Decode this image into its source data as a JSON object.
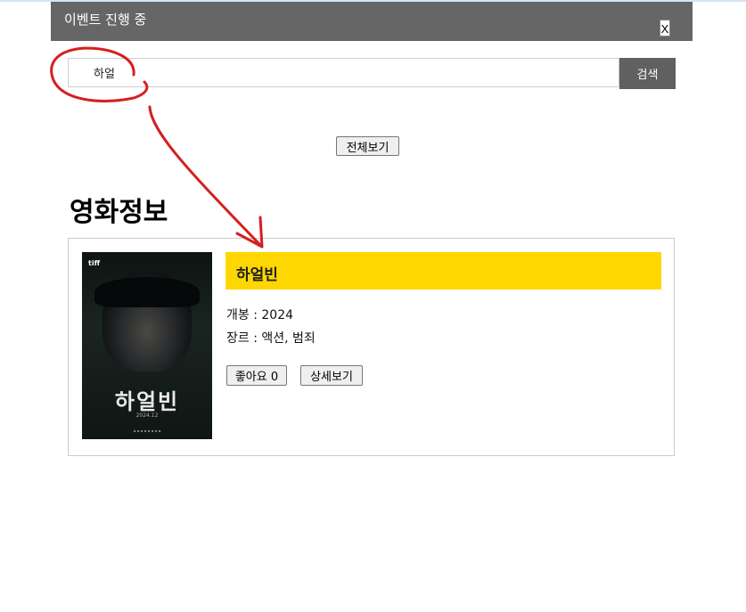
{
  "event_bar": {
    "title": "이벤트 진행 중",
    "close_label": "X"
  },
  "search": {
    "value": "하얼",
    "button_label": "검색"
  },
  "view_all_label": "전체보기",
  "section_title": "영화정보",
  "movie": {
    "title": "하얼빈",
    "release_label": "개봉",
    "release_value": "2024",
    "genre_label": "장르",
    "genre_value": "액션, 범죄",
    "like_label": "좋아요",
    "like_count": "0",
    "detail_label": "상세보기",
    "poster": {
      "badge": "tiff",
      "title": "하얼빈",
      "date": "2024.12"
    }
  },
  "colors": {
    "event_bar": "#666666",
    "search_button": "#606060",
    "title_highlight": "#ffd700",
    "annotation": "#d42020"
  }
}
